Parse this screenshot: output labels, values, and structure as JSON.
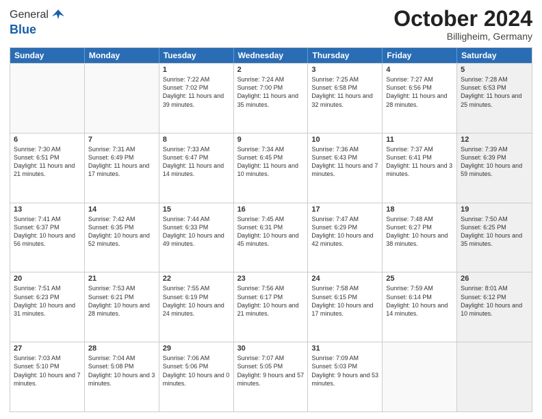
{
  "header": {
    "logo": {
      "general": "General",
      "blue": "Blue"
    },
    "title": "October 2024",
    "location": "Billigheim, Germany"
  },
  "weekdays": [
    "Sunday",
    "Monday",
    "Tuesday",
    "Wednesday",
    "Thursday",
    "Friday",
    "Saturday"
  ],
  "rows": [
    [
      {
        "day": "",
        "sunrise": "",
        "sunset": "",
        "daylight": "",
        "empty": true
      },
      {
        "day": "",
        "sunrise": "",
        "sunset": "",
        "daylight": "",
        "empty": true
      },
      {
        "day": "1",
        "sunrise": "Sunrise: 7:22 AM",
        "sunset": "Sunset: 7:02 PM",
        "daylight": "Daylight: 11 hours and 39 minutes."
      },
      {
        "day": "2",
        "sunrise": "Sunrise: 7:24 AM",
        "sunset": "Sunset: 7:00 PM",
        "daylight": "Daylight: 11 hours and 35 minutes."
      },
      {
        "day": "3",
        "sunrise": "Sunrise: 7:25 AM",
        "sunset": "Sunset: 6:58 PM",
        "daylight": "Daylight: 11 hours and 32 minutes."
      },
      {
        "day": "4",
        "sunrise": "Sunrise: 7:27 AM",
        "sunset": "Sunset: 6:56 PM",
        "daylight": "Daylight: 11 hours and 28 minutes."
      },
      {
        "day": "5",
        "sunrise": "Sunrise: 7:28 AM",
        "sunset": "Sunset: 6:53 PM",
        "daylight": "Daylight: 11 hours and 25 minutes.",
        "shaded": true
      }
    ],
    [
      {
        "day": "6",
        "sunrise": "Sunrise: 7:30 AM",
        "sunset": "Sunset: 6:51 PM",
        "daylight": "Daylight: 11 hours and 21 minutes."
      },
      {
        "day": "7",
        "sunrise": "Sunrise: 7:31 AM",
        "sunset": "Sunset: 6:49 PM",
        "daylight": "Daylight: 11 hours and 17 minutes."
      },
      {
        "day": "8",
        "sunrise": "Sunrise: 7:33 AM",
        "sunset": "Sunset: 6:47 PM",
        "daylight": "Daylight: 11 hours and 14 minutes."
      },
      {
        "day": "9",
        "sunrise": "Sunrise: 7:34 AM",
        "sunset": "Sunset: 6:45 PM",
        "daylight": "Daylight: 11 hours and 10 minutes."
      },
      {
        "day": "10",
        "sunrise": "Sunrise: 7:36 AM",
        "sunset": "Sunset: 6:43 PM",
        "daylight": "Daylight: 11 hours and 7 minutes."
      },
      {
        "day": "11",
        "sunrise": "Sunrise: 7:37 AM",
        "sunset": "Sunset: 6:41 PM",
        "daylight": "Daylight: 11 hours and 3 minutes."
      },
      {
        "day": "12",
        "sunrise": "Sunrise: 7:39 AM",
        "sunset": "Sunset: 6:39 PM",
        "daylight": "Daylight: 10 hours and 59 minutes.",
        "shaded": true
      }
    ],
    [
      {
        "day": "13",
        "sunrise": "Sunrise: 7:41 AM",
        "sunset": "Sunset: 6:37 PM",
        "daylight": "Daylight: 10 hours and 56 minutes."
      },
      {
        "day": "14",
        "sunrise": "Sunrise: 7:42 AM",
        "sunset": "Sunset: 6:35 PM",
        "daylight": "Daylight: 10 hours and 52 minutes."
      },
      {
        "day": "15",
        "sunrise": "Sunrise: 7:44 AM",
        "sunset": "Sunset: 6:33 PM",
        "daylight": "Daylight: 10 hours and 49 minutes."
      },
      {
        "day": "16",
        "sunrise": "Sunrise: 7:45 AM",
        "sunset": "Sunset: 6:31 PM",
        "daylight": "Daylight: 10 hours and 45 minutes."
      },
      {
        "day": "17",
        "sunrise": "Sunrise: 7:47 AM",
        "sunset": "Sunset: 6:29 PM",
        "daylight": "Daylight: 10 hours and 42 minutes."
      },
      {
        "day": "18",
        "sunrise": "Sunrise: 7:48 AM",
        "sunset": "Sunset: 6:27 PM",
        "daylight": "Daylight: 10 hours and 38 minutes."
      },
      {
        "day": "19",
        "sunrise": "Sunrise: 7:50 AM",
        "sunset": "Sunset: 6:25 PM",
        "daylight": "Daylight: 10 hours and 35 minutes.",
        "shaded": true
      }
    ],
    [
      {
        "day": "20",
        "sunrise": "Sunrise: 7:51 AM",
        "sunset": "Sunset: 6:23 PM",
        "daylight": "Daylight: 10 hours and 31 minutes."
      },
      {
        "day": "21",
        "sunrise": "Sunrise: 7:53 AM",
        "sunset": "Sunset: 6:21 PM",
        "daylight": "Daylight: 10 hours and 28 minutes."
      },
      {
        "day": "22",
        "sunrise": "Sunrise: 7:55 AM",
        "sunset": "Sunset: 6:19 PM",
        "daylight": "Daylight: 10 hours and 24 minutes."
      },
      {
        "day": "23",
        "sunrise": "Sunrise: 7:56 AM",
        "sunset": "Sunset: 6:17 PM",
        "daylight": "Daylight: 10 hours and 21 minutes."
      },
      {
        "day": "24",
        "sunrise": "Sunrise: 7:58 AM",
        "sunset": "Sunset: 6:15 PM",
        "daylight": "Daylight: 10 hours and 17 minutes."
      },
      {
        "day": "25",
        "sunrise": "Sunrise: 7:59 AM",
        "sunset": "Sunset: 6:14 PM",
        "daylight": "Daylight: 10 hours and 14 minutes."
      },
      {
        "day": "26",
        "sunrise": "Sunrise: 8:01 AM",
        "sunset": "Sunset: 6:12 PM",
        "daylight": "Daylight: 10 hours and 10 minutes.",
        "shaded": true
      }
    ],
    [
      {
        "day": "27",
        "sunrise": "Sunrise: 7:03 AM",
        "sunset": "Sunset: 5:10 PM",
        "daylight": "Daylight: 10 hours and 7 minutes."
      },
      {
        "day": "28",
        "sunrise": "Sunrise: 7:04 AM",
        "sunset": "Sunset: 5:08 PM",
        "daylight": "Daylight: 10 hours and 3 minutes."
      },
      {
        "day": "29",
        "sunrise": "Sunrise: 7:06 AM",
        "sunset": "Sunset: 5:06 PM",
        "daylight": "Daylight: 10 hours and 0 minutes."
      },
      {
        "day": "30",
        "sunrise": "Sunrise: 7:07 AM",
        "sunset": "Sunset: 5:05 PM",
        "daylight": "Daylight: 9 hours and 57 minutes."
      },
      {
        "day": "31",
        "sunrise": "Sunrise: 7:09 AM",
        "sunset": "Sunset: 5:03 PM",
        "daylight": "Daylight: 9 hours and 53 minutes."
      },
      {
        "day": "",
        "sunrise": "",
        "sunset": "",
        "daylight": "",
        "empty": true
      },
      {
        "day": "",
        "sunrise": "",
        "sunset": "",
        "daylight": "",
        "empty": true,
        "shaded": true
      }
    ]
  ]
}
